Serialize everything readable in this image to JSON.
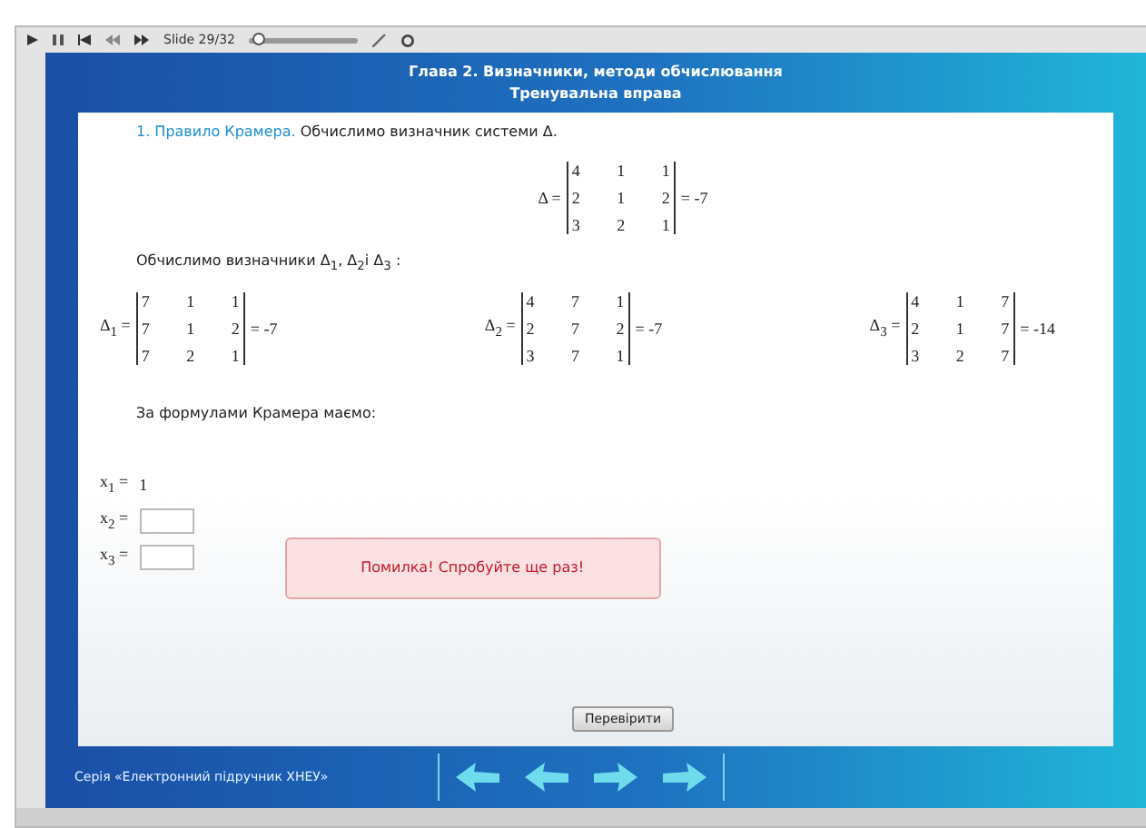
{
  "player": {
    "slide_label": "Slide 29/32",
    "level": 0.03
  },
  "header": {
    "title": "Глава 2. Визначники, методи обчислювання",
    "subtitle": "Тренувальна вправа"
  },
  "intro": "1. Правило Крамера.",
  "intro_text": "Обчислимо визначник системи Δ.",
  "main_det": {
    "label": "Δ =",
    "rows": [
      [
        "4",
        "1",
        "1"
      ],
      [
        "2",
        "1",
        "2"
      ],
      [
        "3",
        "2",
        "1"
      ]
    ],
    "result": "= -7"
  },
  "sub_heading": "Обчислимо визначники Δ$_{1}$, Δ$_{2}$і Δ$_{3}$ :",
  "dets": [
    {
      "label": "Δ$_{1}$ =",
      "rows": [
        [
          "7",
          "1",
          "1"
        ],
        [
          "7",
          "1",
          "2"
        ],
        [
          "7",
          "2",
          "1"
        ]
      ],
      "result": "= -7"
    },
    {
      "label": "Δ$_{2}$ =",
      "rows": [
        [
          "4",
          "7",
          "1"
        ],
        [
          "2",
          "7",
          "2"
        ],
        [
          "3",
          "7",
          "1"
        ]
      ],
      "result": "= -7"
    },
    {
      "label": "Δ$_{3}$ =",
      "rows": [
        [
          "4",
          "1",
          "7"
        ],
        [
          "2",
          "1",
          "7"
        ],
        [
          "3",
          "2",
          "7"
        ]
      ],
      "result": "= -14"
    }
  ],
  "formula_heading": "За формулами Крамера маємо:",
  "answers": [
    {
      "kind": "value",
      "label": "x$_{1}$ =",
      "value": "1"
    },
    {
      "kind": "input",
      "label": "x$_{2}$ ="
    },
    {
      "kind": "input",
      "label": "x$_{3}$ ="
    }
  ],
  "error_message": "Помилка! Спробуйте ще раз!",
  "check_button": "Перевірити",
  "footer": {
    "series": "Серія «Електронний підручник ХНЕУ»"
  }
}
